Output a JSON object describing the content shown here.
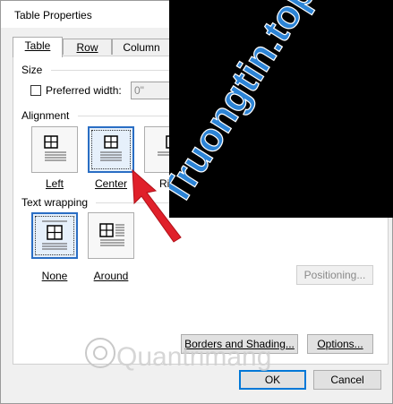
{
  "window": {
    "title": "Table Properties"
  },
  "tabs": [
    {
      "label": "Table",
      "active": true
    },
    {
      "label": "Row",
      "active": false
    },
    {
      "label": "Column",
      "active": false
    }
  ],
  "size": {
    "heading": "Size",
    "preferred_width_label": "Preferred width:",
    "preferred_width_value": "0\"",
    "preferred_width_checked": false
  },
  "alignment": {
    "heading": "Alignment",
    "options": [
      {
        "label": "Left",
        "selected": false
      },
      {
        "label": "Center",
        "selected": true
      },
      {
        "label": "Rig",
        "selected": false
      }
    ]
  },
  "text_wrapping": {
    "heading": "Text wrapping",
    "options": [
      {
        "label": "None",
        "selected": true
      },
      {
        "label": "Around",
        "selected": false
      }
    ]
  },
  "buttons": {
    "positioning": "Positioning...",
    "borders_shading": "Borders and Shading...",
    "options": "Options...",
    "ok": "OK",
    "cancel": "Cancel"
  },
  "watermarks": {
    "overlay_text": "Truongtin.top",
    "bottom_text": "Quantrimang"
  },
  "colors": {
    "overlay_bg": "#000000",
    "overlay_text": "#2d84d6",
    "arrow": "#e0202a",
    "selection": "#2a6ec4"
  },
  "icons": {
    "alignment_option": "table-icon",
    "annotation": "red-arrow"
  }
}
